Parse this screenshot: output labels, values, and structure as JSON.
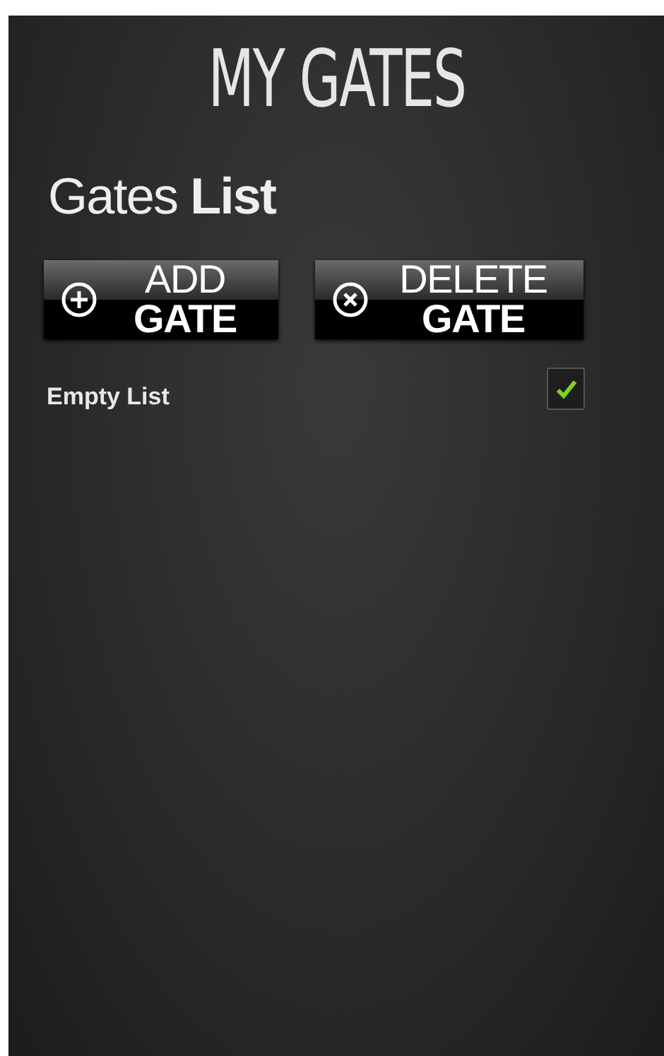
{
  "title": "MY GATES",
  "heading": "Gates **List**",
  "buttons": [
    {
      "kind": "add",
      "label": "ADD **GATE**"
    },
    {
      "kind": "delete",
      "label": "DELETE **GATE**"
    }
  ],
  "items": [
    {
      "label": "Empty List",
      "checked": true
    }
  ]
}
